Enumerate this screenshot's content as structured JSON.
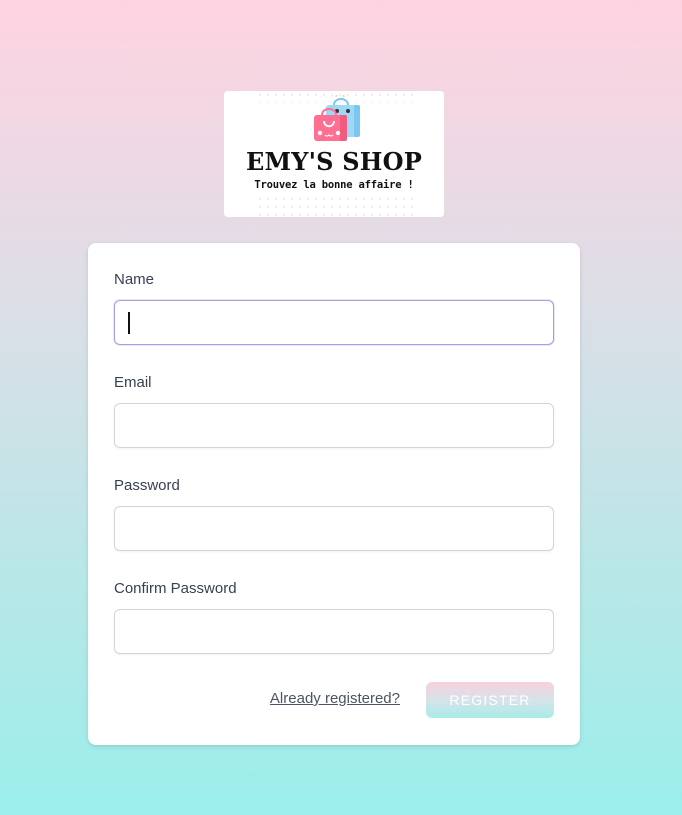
{
  "logo": {
    "title": "EMY'S SHOP",
    "tagline": "Trouvez la bonne affaire !"
  },
  "form": {
    "fields": [
      {
        "label": "Name",
        "value": "",
        "focused": true
      },
      {
        "label": "Email",
        "value": ""
      },
      {
        "label": "Password",
        "value": ""
      },
      {
        "label": "Confirm Password",
        "value": ""
      }
    ],
    "login_link": "Already registered?",
    "register_label": "REGISTER"
  },
  "colors": {
    "background_top": "#ffd3e1",
    "background_bottom": "#9aeeeb",
    "focus_border": "#a5a0e6"
  }
}
